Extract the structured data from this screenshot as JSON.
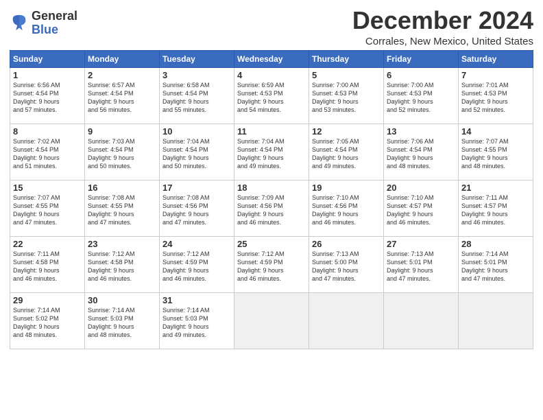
{
  "logo": {
    "name": "General",
    "name2": "Blue"
  },
  "header": {
    "month": "December 2024",
    "location": "Corrales, New Mexico, United States"
  },
  "columns": [
    "Sunday",
    "Monday",
    "Tuesday",
    "Wednesday",
    "Thursday",
    "Friday",
    "Saturday"
  ],
  "weeks": [
    [
      {
        "day": "1",
        "info": "Sunrise: 6:56 AM\nSunset: 4:54 PM\nDaylight: 9 hours\nand 57 minutes."
      },
      {
        "day": "2",
        "info": "Sunrise: 6:57 AM\nSunset: 4:54 PM\nDaylight: 9 hours\nand 56 minutes."
      },
      {
        "day": "3",
        "info": "Sunrise: 6:58 AM\nSunset: 4:54 PM\nDaylight: 9 hours\nand 55 minutes."
      },
      {
        "day": "4",
        "info": "Sunrise: 6:59 AM\nSunset: 4:53 PM\nDaylight: 9 hours\nand 54 minutes."
      },
      {
        "day": "5",
        "info": "Sunrise: 7:00 AM\nSunset: 4:53 PM\nDaylight: 9 hours\nand 53 minutes."
      },
      {
        "day": "6",
        "info": "Sunrise: 7:00 AM\nSunset: 4:53 PM\nDaylight: 9 hours\nand 52 minutes."
      },
      {
        "day": "7",
        "info": "Sunrise: 7:01 AM\nSunset: 4:53 PM\nDaylight: 9 hours\nand 52 minutes."
      }
    ],
    [
      {
        "day": "8",
        "info": "Sunrise: 7:02 AM\nSunset: 4:54 PM\nDaylight: 9 hours\nand 51 minutes."
      },
      {
        "day": "9",
        "info": "Sunrise: 7:03 AM\nSunset: 4:54 PM\nDaylight: 9 hours\nand 50 minutes."
      },
      {
        "day": "10",
        "info": "Sunrise: 7:04 AM\nSunset: 4:54 PM\nDaylight: 9 hours\nand 50 minutes."
      },
      {
        "day": "11",
        "info": "Sunrise: 7:04 AM\nSunset: 4:54 PM\nDaylight: 9 hours\nand 49 minutes."
      },
      {
        "day": "12",
        "info": "Sunrise: 7:05 AM\nSunset: 4:54 PM\nDaylight: 9 hours\nand 49 minutes."
      },
      {
        "day": "13",
        "info": "Sunrise: 7:06 AM\nSunset: 4:54 PM\nDaylight: 9 hours\nand 48 minutes."
      },
      {
        "day": "14",
        "info": "Sunrise: 7:07 AM\nSunset: 4:55 PM\nDaylight: 9 hours\nand 48 minutes."
      }
    ],
    [
      {
        "day": "15",
        "info": "Sunrise: 7:07 AM\nSunset: 4:55 PM\nDaylight: 9 hours\nand 47 minutes."
      },
      {
        "day": "16",
        "info": "Sunrise: 7:08 AM\nSunset: 4:55 PM\nDaylight: 9 hours\nand 47 minutes."
      },
      {
        "day": "17",
        "info": "Sunrise: 7:08 AM\nSunset: 4:56 PM\nDaylight: 9 hours\nand 47 minutes."
      },
      {
        "day": "18",
        "info": "Sunrise: 7:09 AM\nSunset: 4:56 PM\nDaylight: 9 hours\nand 46 minutes."
      },
      {
        "day": "19",
        "info": "Sunrise: 7:10 AM\nSunset: 4:56 PM\nDaylight: 9 hours\nand 46 minutes."
      },
      {
        "day": "20",
        "info": "Sunrise: 7:10 AM\nSunset: 4:57 PM\nDaylight: 9 hours\nand 46 minutes."
      },
      {
        "day": "21",
        "info": "Sunrise: 7:11 AM\nSunset: 4:57 PM\nDaylight: 9 hours\nand 46 minutes."
      }
    ],
    [
      {
        "day": "22",
        "info": "Sunrise: 7:11 AM\nSunset: 4:58 PM\nDaylight: 9 hours\nand 46 minutes."
      },
      {
        "day": "23",
        "info": "Sunrise: 7:12 AM\nSunset: 4:58 PM\nDaylight: 9 hours\nand 46 minutes."
      },
      {
        "day": "24",
        "info": "Sunrise: 7:12 AM\nSunset: 4:59 PM\nDaylight: 9 hours\nand 46 minutes."
      },
      {
        "day": "25",
        "info": "Sunrise: 7:12 AM\nSunset: 4:59 PM\nDaylight: 9 hours\nand 46 minutes."
      },
      {
        "day": "26",
        "info": "Sunrise: 7:13 AM\nSunset: 5:00 PM\nDaylight: 9 hours\nand 47 minutes."
      },
      {
        "day": "27",
        "info": "Sunrise: 7:13 AM\nSunset: 5:01 PM\nDaylight: 9 hours\nand 47 minutes."
      },
      {
        "day": "28",
        "info": "Sunrise: 7:14 AM\nSunset: 5:01 PM\nDaylight: 9 hours\nand 47 minutes."
      }
    ],
    [
      {
        "day": "29",
        "info": "Sunrise: 7:14 AM\nSunset: 5:02 PM\nDaylight: 9 hours\nand 48 minutes."
      },
      {
        "day": "30",
        "info": "Sunrise: 7:14 AM\nSunset: 5:03 PM\nDaylight: 9 hours\nand 48 minutes."
      },
      {
        "day": "31",
        "info": "Sunrise: 7:14 AM\nSunset: 5:03 PM\nDaylight: 9 hours\nand 49 minutes."
      },
      {
        "day": "",
        "info": ""
      },
      {
        "day": "",
        "info": ""
      },
      {
        "day": "",
        "info": ""
      },
      {
        "day": "",
        "info": ""
      }
    ]
  ]
}
